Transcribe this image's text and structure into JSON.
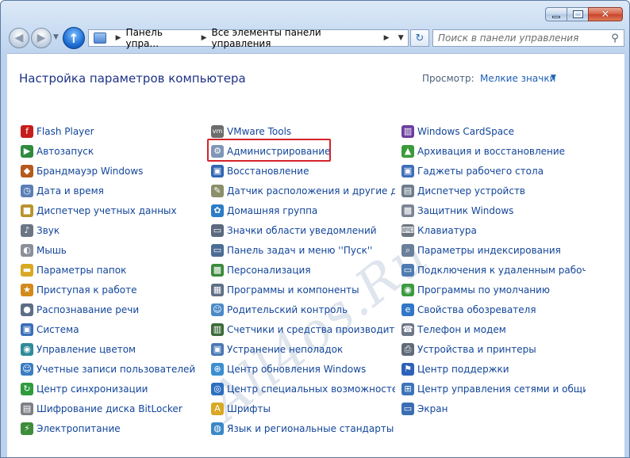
{
  "window": {
    "min": "−",
    "close": "✕"
  },
  "nav": {
    "address_parts": [
      "Панель упра...",
      "Все элементы панели управления"
    ],
    "search_placeholder": "Поиск в панели управления"
  },
  "header": {
    "title": "Настройка параметров компьютера",
    "view_label": "Просмотр:",
    "view_value": "Мелкие значки"
  },
  "watermark": "All4os.Ru",
  "columns": [
    [
      {
        "label": "Flash Player",
        "icon": "flash-icon",
        "color": "#c71c1c",
        "glyph": "f"
      },
      {
        "label": "Автозапуск",
        "icon": "autoplay-icon",
        "color": "#2e8b3e",
        "glyph": "▶"
      },
      {
        "label": "Брандмауэр Windows",
        "icon": "firewall-icon",
        "color": "#b55a1f",
        "glyph": "◆"
      },
      {
        "label": "Дата и время",
        "icon": "clock-icon",
        "color": "#5b7fb7",
        "glyph": "◷"
      },
      {
        "label": "Диспетчер учетных данных",
        "icon": "credentials-icon",
        "color": "#b8932e",
        "glyph": "■"
      },
      {
        "label": "Звук",
        "icon": "sound-icon",
        "color": "#6b7685",
        "glyph": "♪"
      },
      {
        "label": "Мышь",
        "icon": "mouse-icon",
        "color": "#8a8f99",
        "glyph": "◐"
      },
      {
        "label": "Параметры папок",
        "icon": "folder-icon",
        "color": "#d9a925",
        "glyph": "▬"
      },
      {
        "label": "Приступая к работе",
        "icon": "getting-started-icon",
        "color": "#d28a1c",
        "glyph": "★"
      },
      {
        "label": "Распознавание речи",
        "icon": "microphone-icon",
        "color": "#5d6e86",
        "glyph": "●"
      },
      {
        "label": "Система",
        "icon": "system-icon",
        "color": "#3b6fb8",
        "glyph": "▣"
      },
      {
        "label": "Управление цветом",
        "icon": "color-icon",
        "color": "#2f8a9a",
        "glyph": "◉"
      },
      {
        "label": "Учетные записи пользователей",
        "icon": "users-icon",
        "color": "#3a7dc2",
        "glyph": "☺"
      },
      {
        "label": "Центр синхронизации",
        "icon": "sync-icon",
        "color": "#2e9b3c",
        "glyph": "↻"
      },
      {
        "label": "Шифрование диска BitLocker",
        "icon": "bitlocker-icon",
        "color": "#7d7f86",
        "glyph": "▤"
      },
      {
        "label": "Электропитание",
        "icon": "power-icon",
        "color": "#3d8d3a",
        "glyph": "⚡"
      }
    ],
    [
      {
        "label": "VMware Tools",
        "icon": "vmware-icon",
        "color": "#6d6d6d",
        "glyph": "vm"
      },
      {
        "label": "Администрирование",
        "icon": "admin-tools-icon",
        "color": "#7f96b8",
        "glyph": "⚙"
      },
      {
        "label": "Восстановление",
        "icon": "recovery-icon",
        "color": "#2f66b5",
        "glyph": "▣"
      },
      {
        "label": "Датчик расположения и другие дат...",
        "icon": "location-sensor-icon",
        "color": "#8b8f6a",
        "glyph": "✎"
      },
      {
        "label": "Домашняя группа",
        "icon": "homegroup-icon",
        "color": "#2c7cc7",
        "glyph": "✿"
      },
      {
        "label": "Значки области уведомлений",
        "icon": "notification-icon",
        "color": "#5b6a7e",
        "glyph": "▭"
      },
      {
        "label": "Панель задач и меню ''Пуск''",
        "icon": "taskbar-icon",
        "color": "#4b6d95",
        "glyph": "▭"
      },
      {
        "label": "Персонализация",
        "icon": "personalization-icon",
        "color": "#3b8a3c",
        "glyph": "▩"
      },
      {
        "label": "Программы и компоненты",
        "icon": "programs-icon",
        "color": "#5f6e86",
        "glyph": "▦"
      },
      {
        "label": "Родительский контроль",
        "icon": "parental-icon",
        "color": "#4a8ac7",
        "glyph": "☺"
      },
      {
        "label": "Счетчики и средства производител...",
        "icon": "performance-icon",
        "color": "#3d6b3a",
        "glyph": "▥"
      },
      {
        "label": "Устранение неполадок",
        "icon": "troubleshoot-icon",
        "color": "#4a78b4",
        "glyph": "▣"
      },
      {
        "label": "Центр обновления Windows",
        "icon": "windows-update-icon",
        "color": "#3b8fd1",
        "glyph": "⊕"
      },
      {
        "label": "Центр специальных возможностей",
        "icon": "accessibility-icon",
        "color": "#2d6fc0",
        "glyph": "◎"
      },
      {
        "label": "Шрифты",
        "icon": "fonts-icon",
        "color": "#d9a925",
        "glyph": "A"
      },
      {
        "label": "Язык и региональные стандарты",
        "icon": "region-icon",
        "color": "#3a88c9",
        "glyph": "◍"
      }
    ],
    [
      {
        "label": "Windows CardSpace",
        "icon": "cardspace-icon",
        "color": "#6b3fa0",
        "glyph": "▥"
      },
      {
        "label": "Архивация и восстановление",
        "icon": "backup-icon",
        "color": "#3c9a3a",
        "glyph": "▲"
      },
      {
        "label": "Гаджеты рабочего стола",
        "icon": "gadgets-icon",
        "color": "#3f6eb8",
        "glyph": "▣"
      },
      {
        "label": "Диспетчер устройств",
        "icon": "device-manager-icon",
        "color": "#6e7c8c",
        "glyph": "▤"
      },
      {
        "label": "Защитник Windows",
        "icon": "defender-icon",
        "color": "#7c8594",
        "glyph": "▩"
      },
      {
        "label": "Клавиатура",
        "icon": "keyboard-icon",
        "color": "#6d7580",
        "glyph": "⌨"
      },
      {
        "label": "Параметры индексирования",
        "icon": "indexing-icon",
        "color": "#6a7f9a",
        "glyph": "⌕"
      },
      {
        "label": "Подключения к удаленным рабоч...",
        "icon": "remote-desktop-icon",
        "color": "#4e7bb2",
        "glyph": "▭"
      },
      {
        "label": "Программы по умолчанию",
        "icon": "default-programs-icon",
        "color": "#3d9a41",
        "glyph": "◉"
      },
      {
        "label": "Свойства обозревателя",
        "icon": "internet-options-icon",
        "color": "#3277c7",
        "glyph": "e"
      },
      {
        "label": "Телефон и модем",
        "icon": "phone-icon",
        "color": "#6d7787",
        "glyph": "☎"
      },
      {
        "label": "Устройства и принтеры",
        "icon": "printer-icon",
        "color": "#606a78",
        "glyph": "⎙"
      },
      {
        "label": "Центр поддержки",
        "icon": "action-center-icon",
        "color": "#2d62b8",
        "glyph": "⚑"
      },
      {
        "label": "Центр управления сетями и общи...",
        "icon": "network-icon",
        "color": "#3c74b8",
        "glyph": "⊞"
      },
      {
        "label": "Экран",
        "icon": "display-icon",
        "color": "#3b6db3",
        "glyph": "▭"
      }
    ]
  ]
}
